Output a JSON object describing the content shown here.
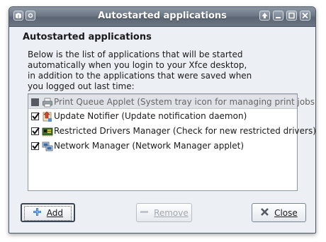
{
  "window": {
    "title": "Autostarted applications"
  },
  "heading": "Autostarted applications",
  "description": [
    "Below is the list of applications that will be started",
    "automatically when you login to your Xfce desktop,",
    "in addition to the applications that were saved when",
    "you logged out last time:"
  ],
  "apps": [
    {
      "label": "Print Queue Applet (System tray icon for managing print jobs)",
      "checked": false,
      "icon": "printer-icon"
    },
    {
      "label": "Update Notifier (Update notification daemon)",
      "checked": true,
      "icon": "update-notifier-icon"
    },
    {
      "label": "Restricted Drivers Manager (Check for new restricted drivers)",
      "checked": true,
      "icon": "restricted-drivers-icon"
    },
    {
      "label": "Network Manager (Network Manager applet)",
      "checked": true,
      "icon": "network-manager-icon"
    }
  ],
  "buttons": {
    "add": "Add",
    "remove": "Remove",
    "close": "Close"
  },
  "colors": {
    "titlebar": "#6c7684",
    "window_bg": "#eceff3",
    "selected_row": "#dfe3e8"
  }
}
